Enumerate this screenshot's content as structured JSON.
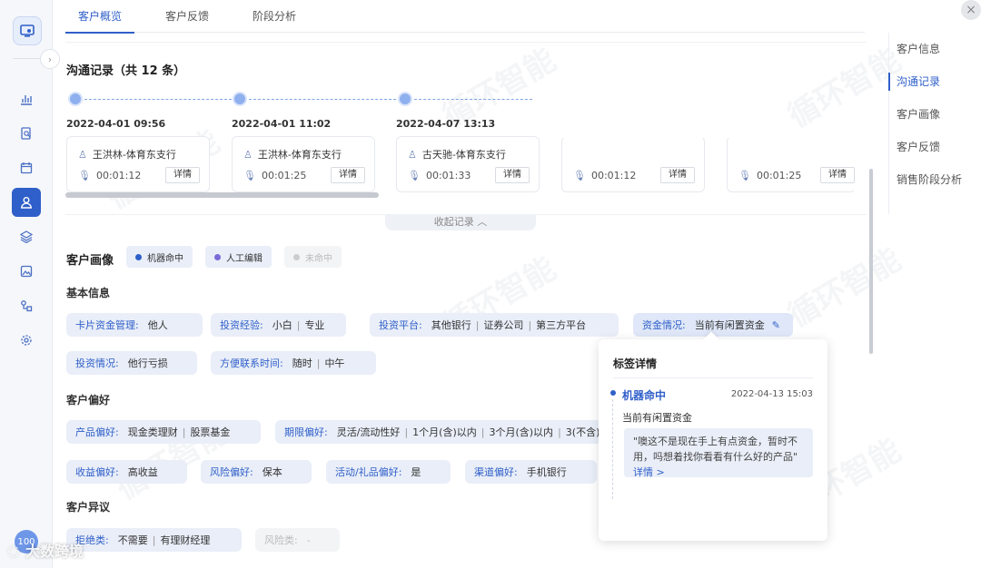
{
  "tabs": [
    "客户概览",
    "客户反馈",
    "阶段分析"
  ],
  "anchors": [
    "客户信息",
    "沟通记录",
    "客户画像",
    "客户反馈",
    "销售阶段分析"
  ],
  "comm": {
    "title": "沟通记录（共 12 条）",
    "records": [
      {
        "date": "2022-04-01 09:56",
        "agent": "王洪林-体育东支行",
        "duration": "00:01:12",
        "detail": "详情"
      },
      {
        "date": "2022-04-01 11:02",
        "agent": "王洪林-体育东支行",
        "duration": "00:01:25",
        "detail": "详情"
      },
      {
        "date": "2022-04-07 13:13",
        "agent": "古天驰-体育东支行",
        "duration": "00:01:33",
        "detail": "详情"
      },
      {
        "date": "",
        "agent": "",
        "duration": "00:01:12",
        "detail": "详情"
      },
      {
        "date": "",
        "agent": "",
        "duration": "00:01:25",
        "detail": "详情"
      }
    ],
    "collapse_label": "收起记录 ︿"
  },
  "portrait": {
    "title": "客户画像",
    "legend": [
      {
        "label": "机器命中",
        "color": "#2f5fc9"
      },
      {
        "label": "人工编辑",
        "color": "#7b6ad8"
      },
      {
        "label": "未命中",
        "color": "#cccccc"
      }
    ],
    "groups": {
      "basic": "基本信息",
      "pref": "客户偏好",
      "objection": "客户异议"
    },
    "tags": {
      "card_funds": {
        "k": "卡片资金管理:",
        "v": [
          "他人"
        ]
      },
      "invest_exp": {
        "k": "投资经验:",
        "v": [
          "小白",
          "专业"
        ]
      },
      "invest_platform": {
        "k": "投资平台:",
        "v": [
          "其他银行",
          "证券公司",
          "第三方平台"
        ]
      },
      "funds": {
        "k": "资金情况:",
        "v": [
          "当前有闲置资金"
        ]
      },
      "invest_status": {
        "k": "投资情况:",
        "v": [
          "他行亏损"
        ]
      },
      "contact_time": {
        "k": "方便联系时间:",
        "v": [
          "随时",
          "中午"
        ]
      },
      "product_pref": {
        "k": "产品偏好:",
        "v": [
          "现金类理财",
          "股票基金"
        ]
      },
      "term_pref": {
        "k": "期限偏好:",
        "v": [
          "灵活/流动性好",
          "1个月(含)以内",
          "3个月(含)以内",
          "3(不含)"
        ]
      },
      "yield_pref": {
        "k": "收益偏好:",
        "v": [
          "高收益"
        ]
      },
      "risk_pref": {
        "k": "风险偏好:",
        "v": [
          "保本"
        ]
      },
      "gift_pref": {
        "k": "活动/礼品偏好:",
        "v": [
          "是"
        ]
      },
      "channel_pref": {
        "k": "渠道偏好:",
        "v": [
          "手机银行"
        ]
      },
      "reject": {
        "k": "拒绝类:",
        "v": [
          "不需要",
          "有理财经理"
        ]
      },
      "risk_class": {
        "k": "风险类:",
        "v": [
          "-"
        ]
      }
    }
  },
  "popover": {
    "title": "标签详情",
    "source": "机器命中",
    "time": "2022-04-13 15:03",
    "value": "当前有闲置资金",
    "quote": "\"噢这不是现在手上有点资金，暂时不用，吗想着找你看看有什么好的产品\"",
    "link": "详情 >"
  },
  "watermark": "循环智能",
  "brand": "大数跨境",
  "avatar": "100"
}
